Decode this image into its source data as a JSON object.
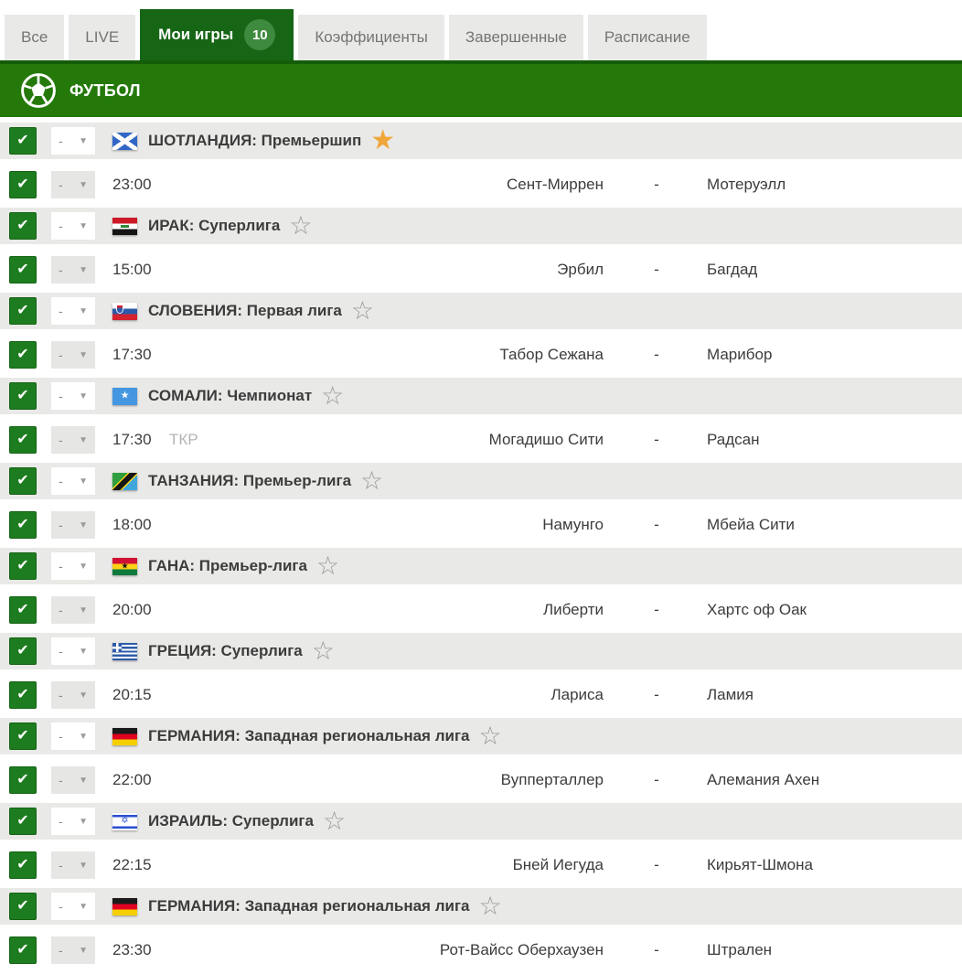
{
  "tabs": {
    "items": [
      {
        "id": "all",
        "label": "Все",
        "active": false
      },
      {
        "id": "live",
        "label": "LIVE",
        "active": false
      },
      {
        "id": "my-games",
        "label": "Мои игры",
        "badge": "10",
        "active": true
      },
      {
        "id": "odds",
        "label": "Коэффициенты",
        "active": false
      },
      {
        "id": "finished",
        "label": "Завершенные",
        "active": false
      },
      {
        "id": "schedule",
        "label": "Расписание",
        "active": false
      }
    ]
  },
  "sport_header": {
    "label": "ФУТБОЛ",
    "icon": "football-icon"
  },
  "row_controls": {
    "dropdown_value": "-",
    "checkbox_checked": true
  },
  "separator": "-",
  "icons": {
    "checkmark": "✔",
    "dropdown_arrow": "▼",
    "star_filled": "★",
    "star_outline": "☆"
  },
  "colors": {
    "active_tab_green": "#166616",
    "badge_green": "#3e8a3e",
    "sport_bar_green": "#24790a",
    "sport_bar_border": "#145d08",
    "checkbox_green": "#1d7c1f",
    "favorite_star_gold": "#f0a73a",
    "league_row_gray": "#e9e9e7",
    "tab_gray": "#e9e9e7",
    "text_dark": "#3c3c3c",
    "muted_text": "#b4b4b4"
  },
  "leagues": [
    {
      "flag": "scotland",
      "name": "ШОТЛАНДИЯ: Премьершип",
      "favorite": true,
      "matches": [
        {
          "time": "23:00",
          "home": "Сент-Миррен",
          "away": "Мотеруэлл"
        }
      ]
    },
    {
      "flag": "iraq",
      "name": "ИРАК: Суперлига",
      "favorite": false,
      "matches": [
        {
          "time": "15:00",
          "home": "Эрбил",
          "away": "Багдад"
        }
      ]
    },
    {
      "flag": "slovenia",
      "name": "СЛОВЕНИЯ: Первая лига",
      "favorite": false,
      "matches": [
        {
          "time": "17:30",
          "home": "Табор Сежана",
          "away": "Марибор"
        }
      ]
    },
    {
      "flag": "somalia",
      "name": "СОМАЛИ: Чемпионат",
      "favorite": false,
      "matches": [
        {
          "time": "17:30",
          "status": "ТКР",
          "home": "Могадишо Сити",
          "away": "Радсан"
        }
      ]
    },
    {
      "flag": "tanzania",
      "name": "ТАНЗАНИЯ: Премьер-лига",
      "favorite": false,
      "matches": [
        {
          "time": "18:00",
          "home": "Намунго",
          "away": "Мбейа Сити"
        }
      ]
    },
    {
      "flag": "ghana",
      "name": "ГАНА: Премьер-лига",
      "favorite": false,
      "matches": [
        {
          "time": "20:00",
          "home": "Либерти",
          "away": "Хартс оф Оак"
        }
      ]
    },
    {
      "flag": "greece",
      "name": "ГРЕЦИЯ: Суперлига",
      "favorite": false,
      "matches": [
        {
          "time": "20:15",
          "home": "Лариса",
          "away": "Ламия"
        }
      ]
    },
    {
      "flag": "germany",
      "name": "ГЕРМАНИЯ: Западная региональная лига",
      "favorite": false,
      "matches": [
        {
          "time": "22:00",
          "home": "Вупперталлер",
          "away": "Алемания Ахен"
        }
      ]
    },
    {
      "flag": "israel",
      "name": "ИЗРАИЛЬ: Суперлига",
      "favorite": false,
      "matches": [
        {
          "time": "22:15",
          "home": "Бней Иегуда",
          "away": "Кирьят-Шмона"
        }
      ]
    },
    {
      "flag": "germany",
      "name": "ГЕРМАНИЯ: Западная региональная лига",
      "favorite": false,
      "matches": [
        {
          "time": "23:30",
          "home": "Рот-Вайсс Оберхаузен",
          "away": "Штрален"
        }
      ]
    }
  ]
}
